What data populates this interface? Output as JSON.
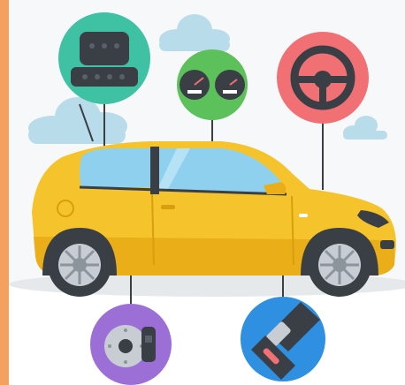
{
  "scene": {
    "subject": "yellow-hatchback-car",
    "callouts": [
      {
        "name": "seat-icon",
        "color": "#3FC1A4"
      },
      {
        "name": "dashboard-gauges-icon",
        "color": "#5CC15A"
      },
      {
        "name": "steering-wheel-icon",
        "color": "#F07074"
      },
      {
        "name": "brake-disc-icon",
        "color": "#9C6FD6"
      },
      {
        "name": "seatbelt-icon",
        "color": "#2F8FE0"
      }
    ],
    "colors": {
      "border": "#F4A15F",
      "sky": "#F6F8FA",
      "cloud": "#B8DCEA",
      "car_body": "#F5C42C",
      "car_shade": "#E9AE18",
      "window": "#8FD0EE",
      "tyre": "#3A3F45",
      "rim": "#C7CDD3",
      "ground": "#E6E9EC"
    }
  }
}
